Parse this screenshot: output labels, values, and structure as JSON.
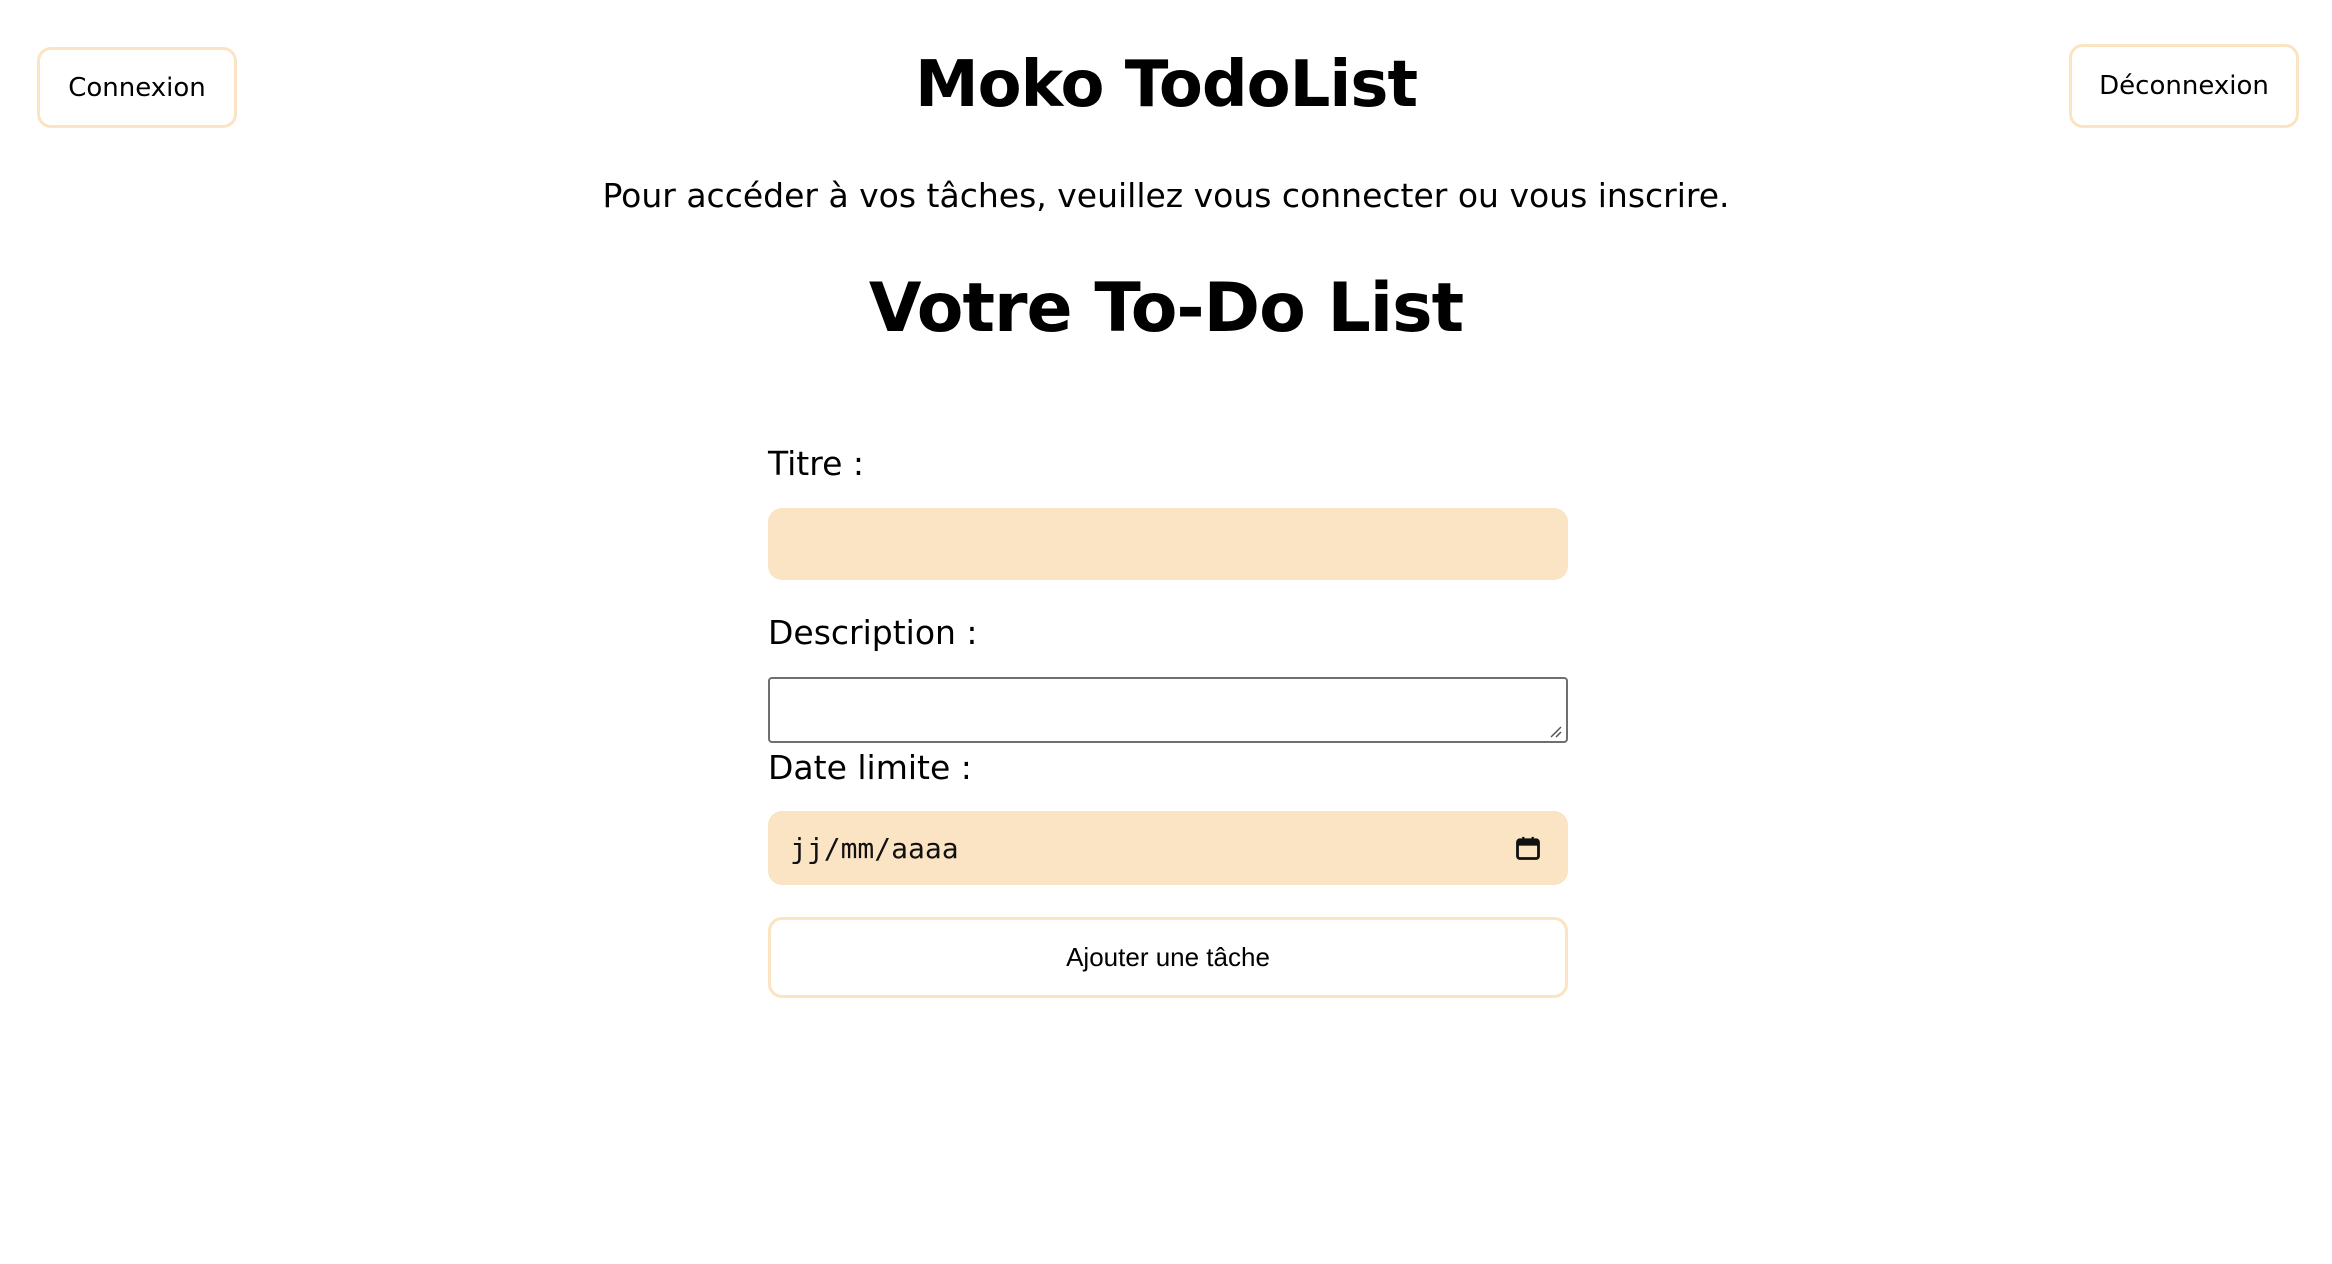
{
  "header": {
    "login_label": "Connexion",
    "logout_label": "Déconnexion",
    "app_title": "Moko TodoList"
  },
  "intro_text": "Pour accéder à vos tâches, veuillez vous connecter ou vous inscrire.",
  "list_title": "Votre To-Do List",
  "form": {
    "title_label": "Titre :",
    "title_value": "",
    "description_label": "Description :",
    "description_value": "",
    "due_date_label": "Date limite :",
    "due_date_placeholder": "jj/mm/aaaa",
    "submit_label": "Ajouter une tâche"
  },
  "colors": {
    "accent": "#fbe4c4",
    "text": "#000000",
    "background": "#ffffff"
  },
  "icons": {
    "date_picker": "calendar-icon",
    "textarea_resize": "resize-grip-icon"
  }
}
